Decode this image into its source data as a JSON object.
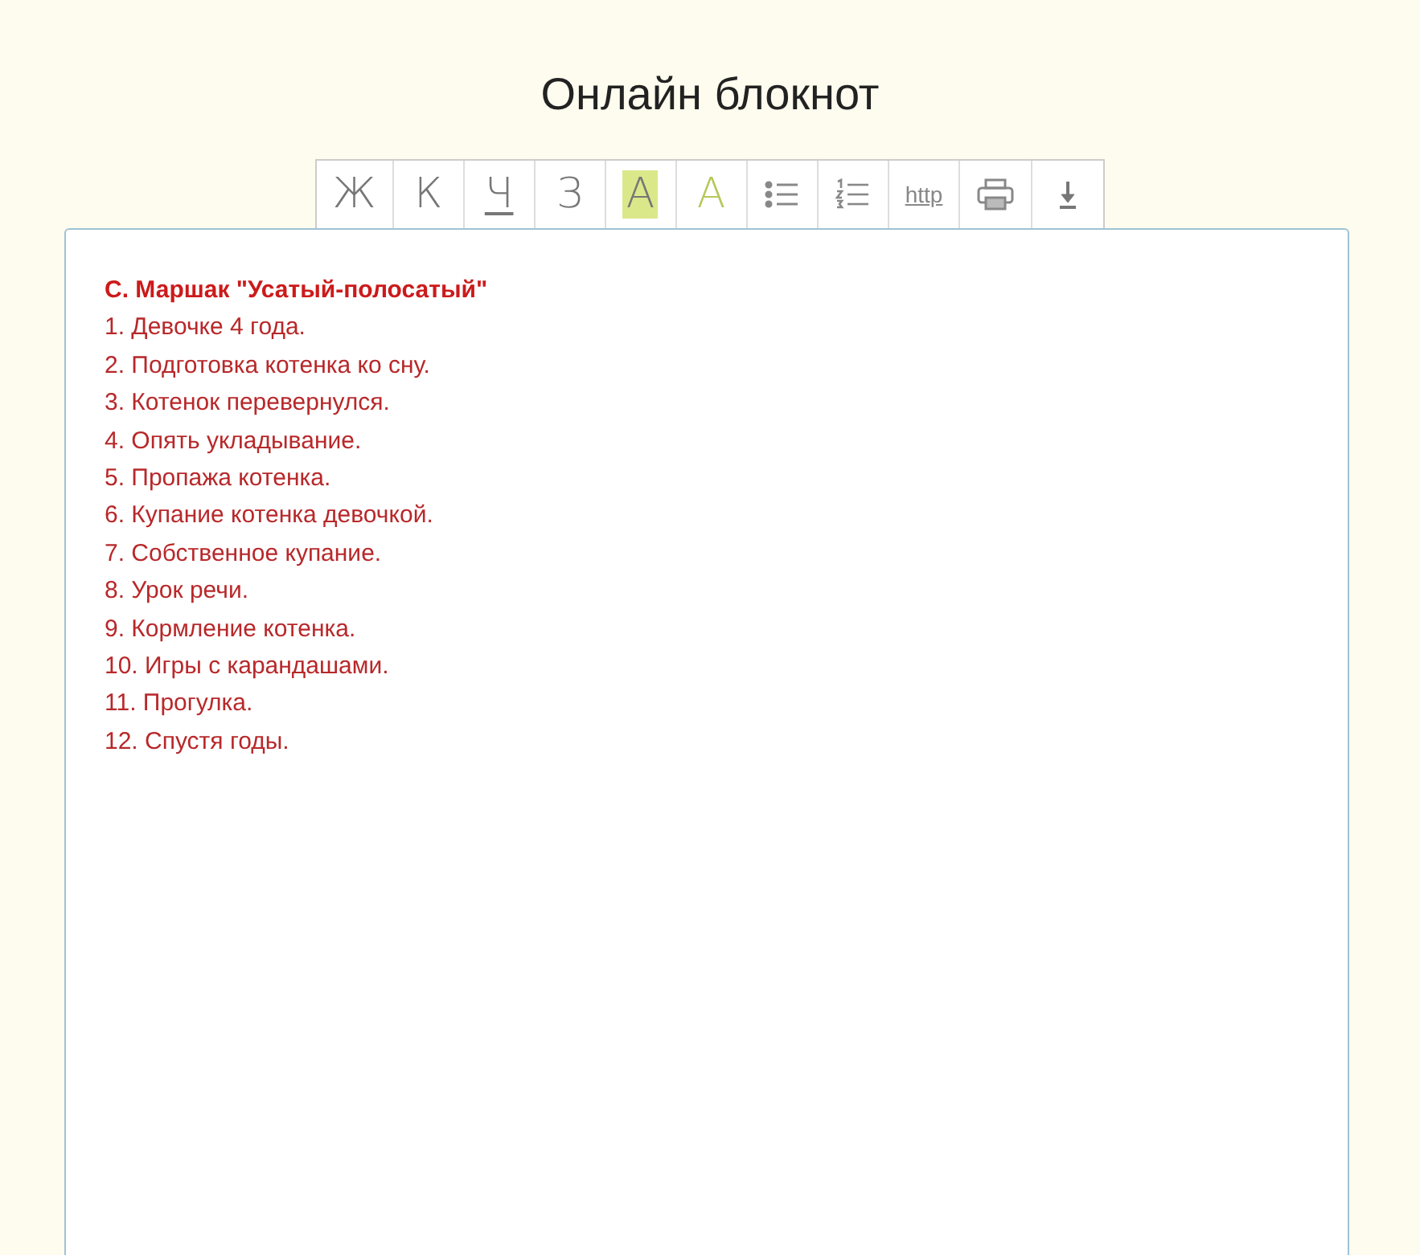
{
  "title": "Онлайн блокнот",
  "toolbar": [
    {
      "kind": "text",
      "label": "Ж"
    },
    {
      "kind": "text",
      "label": "К"
    },
    {
      "kind": "underline",
      "label": "Ч"
    },
    {
      "kind": "text",
      "label": "З"
    },
    {
      "kind": "highlight",
      "label": "A"
    },
    {
      "kind": "font-color",
      "label": "A"
    },
    {
      "kind": "bullet-list"
    },
    {
      "kind": "number-list"
    },
    {
      "kind": "link",
      "label": "http"
    },
    {
      "kind": "print"
    },
    {
      "kind": "download"
    }
  ],
  "editor": {
    "lines": [
      {
        "kind": "title",
        "text": "С. Маршак \"Усатый-полосатый\""
      },
      {
        "kind": "line",
        "text": "1. Девочке 4 года."
      },
      {
        "kind": "line",
        "text": "2. Подготовка котенка ко сну."
      },
      {
        "kind": "line",
        "text": "3. Котенок перевернулся."
      },
      {
        "kind": "line",
        "text": "4. Опять укладывание."
      },
      {
        "kind": "line",
        "text": "5. Пропажа котенка."
      },
      {
        "kind": "line",
        "text": "6. Купание котенка девочкой."
      },
      {
        "kind": "line",
        "text": "7. Собственное купание."
      },
      {
        "kind": "line",
        "text": "8. Урок речи."
      },
      {
        "kind": "line",
        "text": "9. Кормление котенка."
      },
      {
        "kind": "line",
        "text": "10. Игры с карандашами."
      },
      {
        "kind": "line",
        "text": "11. Прогулка."
      },
      {
        "kind": "line",
        "text": "12. Спустя годы."
      }
    ]
  }
}
